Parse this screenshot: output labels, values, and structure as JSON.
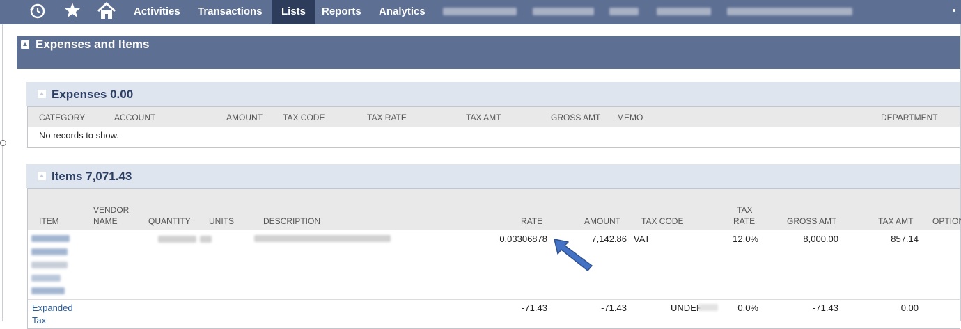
{
  "nav": {
    "items": [
      "Activities",
      "Transactions",
      "Lists",
      "Reports",
      "Analytics"
    ],
    "active": "Lists",
    "icons": [
      "recent-icon",
      "star-icon",
      "home-icon"
    ]
  },
  "main_section": {
    "title": "Expenses and Items"
  },
  "expenses": {
    "title": "Expenses 0.00",
    "columns": [
      "CATEGORY",
      "ACCOUNT",
      "AMOUNT",
      "TAX CODE",
      "TAX RATE",
      "TAX AMT",
      "GROSS AMT",
      "MEMO",
      "DEPARTMENT"
    ],
    "empty_message": "No records to show."
  },
  "items": {
    "title": "Items 7,071.43",
    "columns": {
      "item": "ITEM",
      "vendor_name_1": "VENDOR",
      "vendor_name_2": "NAME",
      "quantity": "QUANTITY",
      "units": "UNITS",
      "description": "DESCRIPTION",
      "rate": "RATE",
      "amount": "AMOUNT",
      "tax_code": "TAX CODE",
      "tax_rate_1": "TAX",
      "tax_rate_2": "RATE",
      "gross_amt": "GROSS AMT",
      "tax_amt": "TAX AMT",
      "options": "OPTION"
    },
    "rows": [
      {
        "item": "",
        "rate": "0.03306878",
        "amount": "7,142.86",
        "tax_code": "VAT",
        "tax_rate": "12.0%",
        "gross_amt": "8,000.00",
        "tax_amt": "857.14"
      },
      {
        "item": "Expanded",
        "item_2": "Tax",
        "rate": "-71.43",
        "amount": "-71.43",
        "tax_code": "UNDEF",
        "tax_rate": "0.0%",
        "gross_amt": "-71.43",
        "tax_amt": "0.00"
      }
    ]
  },
  "colors": {
    "nav_bg": "#5d6f93",
    "nav_active": "#2d3c5a",
    "sub_bg": "#dfe5ee",
    "link": "#2c5b94",
    "arrow": "#4472c4"
  }
}
